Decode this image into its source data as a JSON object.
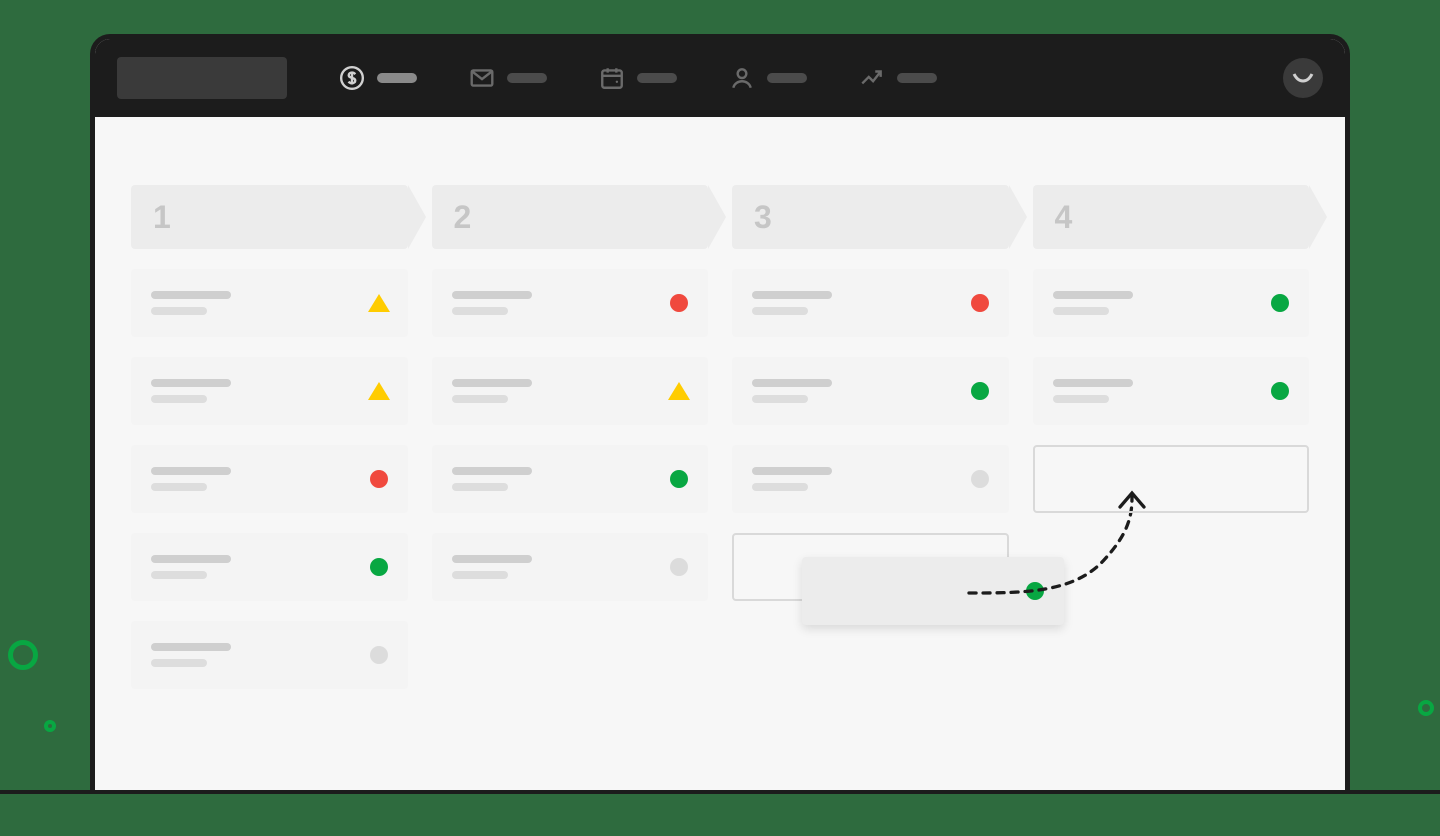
{
  "nav": {
    "items": [
      {
        "name": "deals",
        "icon": "dollar-icon",
        "active": true
      },
      {
        "name": "mail",
        "icon": "mail-icon",
        "active": false
      },
      {
        "name": "calendar",
        "icon": "calendar-icon",
        "active": false
      },
      {
        "name": "contacts",
        "icon": "contacts-icon",
        "active": false
      },
      {
        "name": "insights",
        "icon": "trend-icon",
        "active": false
      }
    ]
  },
  "stages": [
    {
      "label": "1",
      "cards": [
        {
          "status": "yellow"
        },
        {
          "status": "yellow"
        },
        {
          "status": "red"
        },
        {
          "status": "green"
        },
        {
          "status": "grey"
        }
      ]
    },
    {
      "label": "2",
      "cards": [
        {
          "status": "red"
        },
        {
          "status": "yellow"
        },
        {
          "status": "green"
        },
        {
          "status": "grey"
        }
      ]
    },
    {
      "label": "3",
      "cards": [
        {
          "status": "red"
        },
        {
          "status": "green"
        },
        {
          "status": "grey"
        },
        {
          "status": "dropzone"
        }
      ],
      "dragging_card": {
        "status": "green"
      }
    },
    {
      "label": "4",
      "cards": [
        {
          "status": "green"
        },
        {
          "status": "green"
        },
        {
          "status": "dropzone"
        }
      ]
    }
  ],
  "colors": {
    "green": "#08a742",
    "red": "#f0493e",
    "yellow": "#ffcc00",
    "grey": "#dcdcdc",
    "bg": "#2e6b3e"
  }
}
